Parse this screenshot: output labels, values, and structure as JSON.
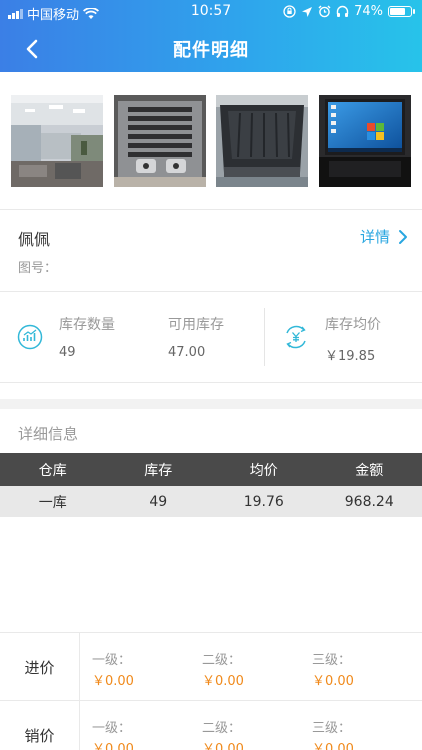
{
  "status_bar": {
    "carrier": "中国移动",
    "time": "10:57",
    "battery_percent": "74%",
    "battery_level": 0.74
  },
  "nav": {
    "title": "配件明细",
    "back_icon": "chevron-left-icon"
  },
  "photos": [
    {
      "name": "office-photo"
    },
    {
      "name": "metal-part-photo"
    },
    {
      "name": "truck-bed-photo"
    },
    {
      "name": "laptop-photo"
    }
  ],
  "part": {
    "name": "佩佩",
    "detail_link": "详情",
    "drawing_no_label": "图号："
  },
  "stock": {
    "qty_label": "库存数量",
    "qty_value": "49",
    "avail_label": "可用库存",
    "avail_value": "47.00",
    "avg_label": "库存均价",
    "avg_value": "￥19.85"
  },
  "detail_section": {
    "title": "详细信息"
  },
  "table": {
    "headers": [
      "仓库",
      "库存",
      "均价",
      "金额"
    ],
    "rows": [
      [
        "一库",
        "49",
        "19.76",
        "968.24"
      ]
    ]
  },
  "prices": {
    "purchase": {
      "label": "进价",
      "levels": [
        {
          "label": "一级：",
          "value": "￥0.00"
        },
        {
          "label": "二级：",
          "value": "￥0.00"
        },
        {
          "label": "三级：",
          "value": "￥0.00"
        }
      ]
    },
    "sale": {
      "label": "销价",
      "levels": [
        {
          "label": "一级：",
          "value": "￥0.00"
        },
        {
          "label": "二级：",
          "value": "￥0.00"
        },
        {
          "label": "三级：",
          "value": "￥0.00"
        }
      ]
    }
  },
  "colors": {
    "header_start": "#3b7fe6",
    "header_end": "#27c3ea",
    "link": "#29a6e0",
    "price": "#f08a1c",
    "table_header": "#4a4a4a"
  }
}
